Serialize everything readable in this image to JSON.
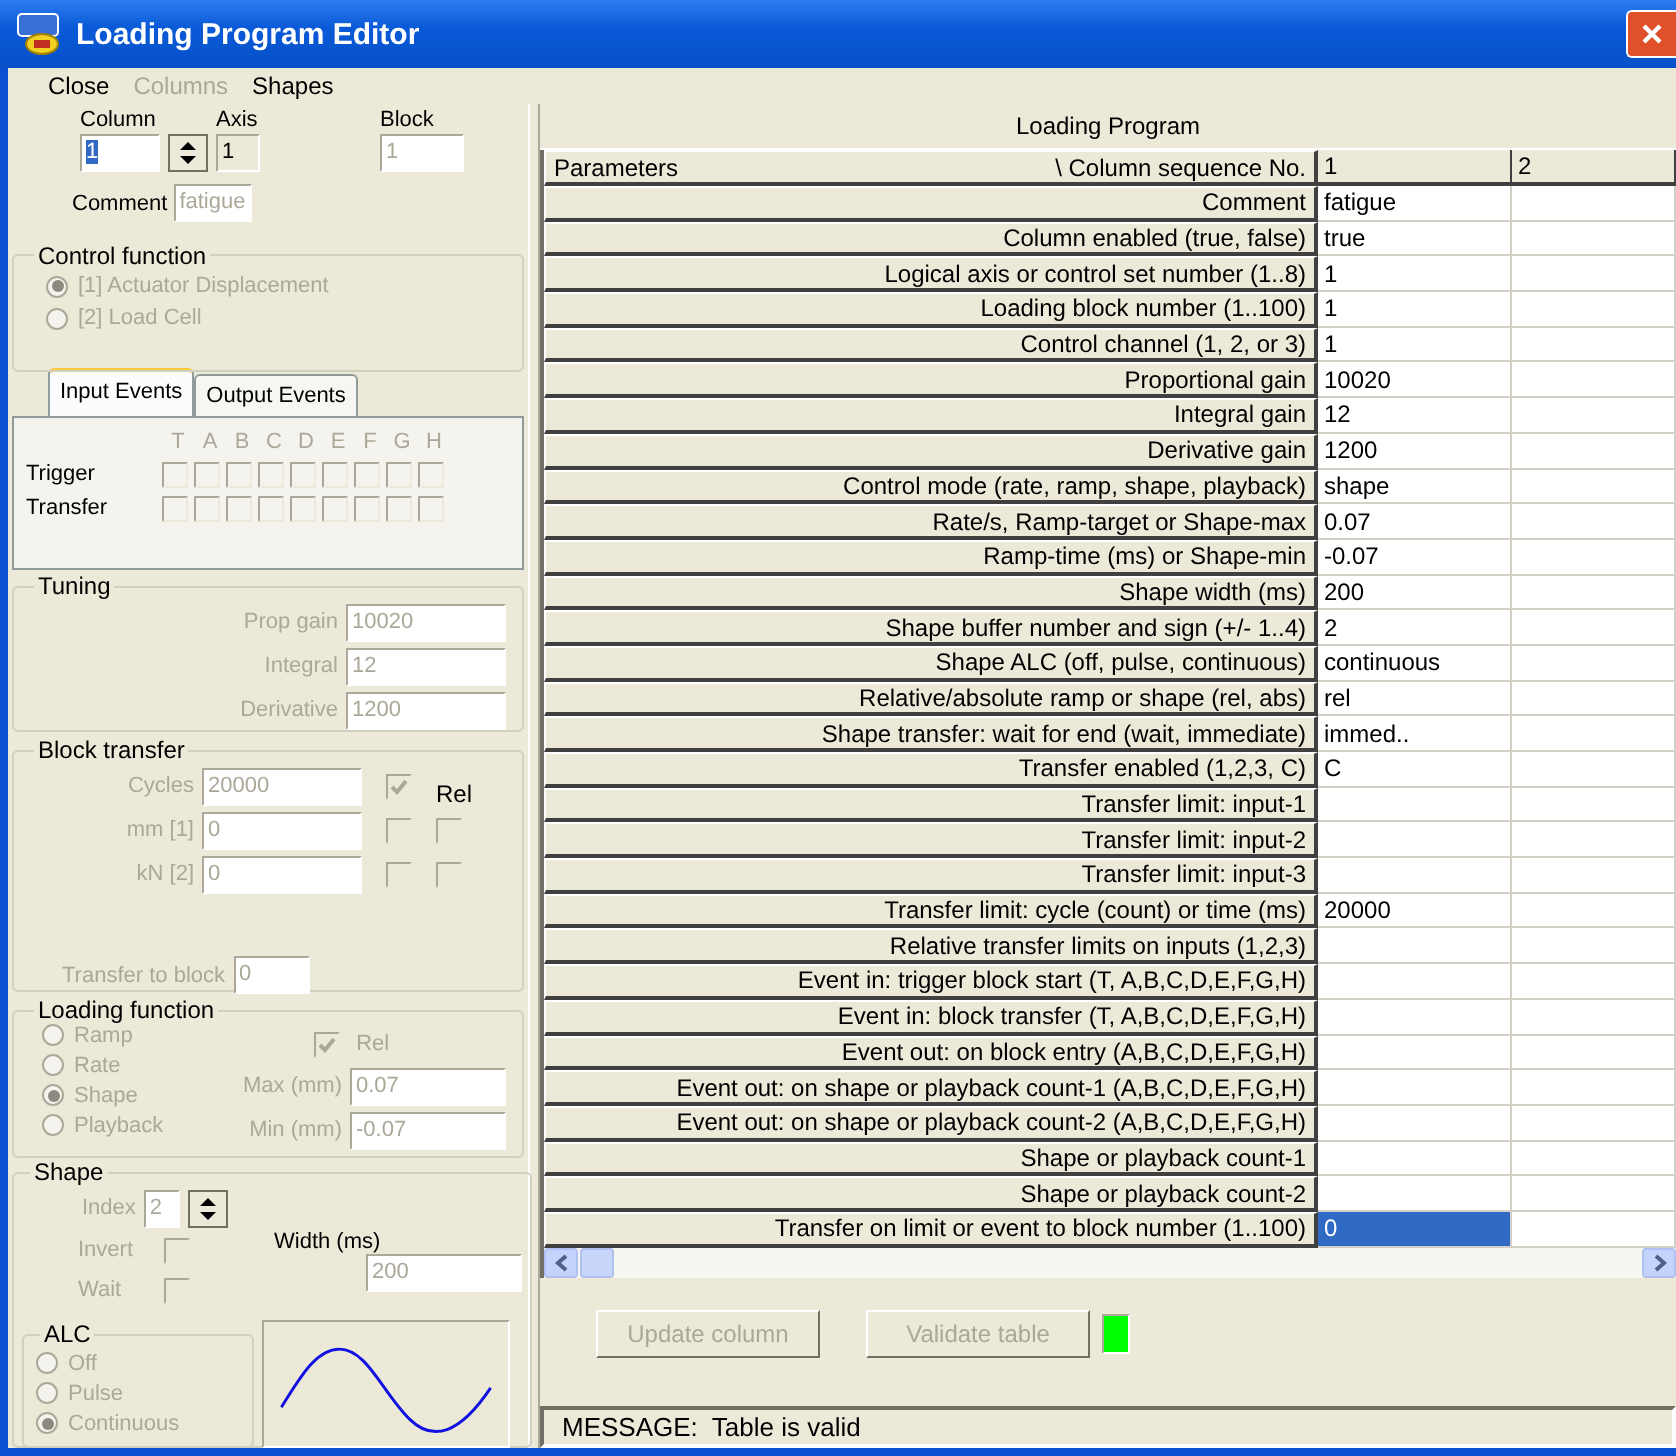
{
  "window": {
    "title": "Loading Program Editor"
  },
  "menu": [
    {
      "label": "Close",
      "disabled": false
    },
    {
      "label": "Columns",
      "disabled": true
    },
    {
      "label": "Shapes",
      "disabled": false
    }
  ],
  "selector": {
    "fields": [
      {
        "label": "Column",
        "value": "1",
        "kind": "spin",
        "disabled": false,
        "selected": true
      },
      {
        "label": "Axis",
        "value": "1",
        "kind": "readonly",
        "disabled": false,
        "selected": false
      },
      {
        "label": "Block",
        "value": "1",
        "kind": "text",
        "disabled": true,
        "selected": false
      }
    ],
    "comment": {
      "label": "Comment",
      "value": "fatigue",
      "disabled": true
    }
  },
  "control_function": {
    "title": "Control function",
    "disabled": true,
    "options": [
      {
        "label": "[1] Actuator Displacement",
        "selected": true
      },
      {
        "label": "[2] Load Cell",
        "selected": false
      }
    ]
  },
  "events": {
    "tabs": [
      {
        "label": "Input Events",
        "selected": true
      },
      {
        "label": "Output Events",
        "selected": false
      }
    ],
    "disabled": true,
    "letters": [
      "T",
      "A",
      "B",
      "C",
      "D",
      "E",
      "F",
      "G",
      "H"
    ],
    "rows": [
      {
        "label": "Trigger",
        "checks": [
          false,
          false,
          false,
          false,
          false,
          false,
          false,
          false,
          false
        ]
      },
      {
        "label": "Transfer",
        "checks": [
          false,
          false,
          false,
          false,
          false,
          false,
          false,
          false,
          false
        ]
      }
    ]
  },
  "tuning": {
    "title": "Tuning",
    "disabled": true,
    "fields": [
      {
        "label": "Prop gain",
        "value": "10020"
      },
      {
        "label": "Integral",
        "value": "12"
      },
      {
        "label": "Derivative",
        "value": "1200"
      }
    ]
  },
  "block_transfer": {
    "title": "Block transfer",
    "disabled": true,
    "rel_label": "Rel",
    "rows": [
      {
        "label": "Cycles",
        "value": "20000",
        "checks": [
          true
        ]
      },
      {
        "label": "mm [1]",
        "value": "0",
        "checks": [
          false,
          false
        ]
      },
      {
        "label": "kN [2]",
        "value": "0",
        "checks": [
          false,
          false
        ]
      }
    ],
    "transfer_to_block": {
      "label": "Transfer to block",
      "value": "0"
    }
  },
  "loading_function": {
    "title": "Loading function",
    "disabled": true,
    "options": [
      {
        "label": "Ramp",
        "selected": false
      },
      {
        "label": "Rate",
        "selected": false
      },
      {
        "label": "Shape",
        "selected": true
      },
      {
        "label": "Playback",
        "selected": false
      }
    ],
    "rel": {
      "label": "Rel",
      "checked": true
    },
    "fields": [
      {
        "label": "Max (mm)",
        "value": "0.07"
      },
      {
        "label": "Min (mm)",
        "value": "-0.07"
      }
    ]
  },
  "shape": {
    "title": "Shape",
    "disabled": true,
    "index": {
      "label": "Index",
      "value": "2"
    },
    "checks": [
      {
        "label": "Invert",
        "checked": false
      },
      {
        "label": "Wait",
        "checked": false
      }
    ],
    "width": {
      "label": "Width (ms)",
      "value": "200"
    },
    "alc": {
      "title": "ALC",
      "options": [
        {
          "label": "Off",
          "selected": false
        },
        {
          "label": "Pulse",
          "selected": false
        },
        {
          "label": "Continuous",
          "selected": true
        }
      ]
    }
  },
  "table": {
    "title": "Loading Program",
    "header": {
      "parameters": "Parameters",
      "sequence": "\\ Column sequence No.",
      "columns": [
        "1",
        "2"
      ]
    },
    "rows": [
      {
        "label": "Comment",
        "value": "fatigue",
        "selected": false
      },
      {
        "label": "Column enabled (true, false)",
        "value": "true",
        "selected": false
      },
      {
        "label": "Logical axis or control set number (1..8)",
        "value": "1",
        "selected": false
      },
      {
        "label": "Loading block number (1..100)",
        "value": "1",
        "selected": false
      },
      {
        "label": "Control channel (1, 2, or 3)",
        "value": "1",
        "selected": false
      },
      {
        "label": "Proportional gain",
        "value": "10020",
        "selected": false
      },
      {
        "label": "Integral gain",
        "value": "12",
        "selected": false
      },
      {
        "label": "Derivative gain",
        "value": "1200",
        "selected": false
      },
      {
        "label": "Control mode (rate, ramp, shape, playback)",
        "value": "shape",
        "selected": false
      },
      {
        "label": "Rate/s, Ramp-target or Shape-max",
        "value": "0.07",
        "selected": false
      },
      {
        "label": "Ramp-time (ms) or Shape-min",
        "value": "-0.07",
        "selected": false
      },
      {
        "label": "Shape width (ms)",
        "value": "200",
        "selected": false
      },
      {
        "label": "Shape buffer number and sign (+/- 1..4)",
        "value": "2",
        "selected": false
      },
      {
        "label": "Shape ALC (off, pulse, continuous)",
        "value": "continuous",
        "selected": false
      },
      {
        "label": "Relative/absolute ramp or shape (rel, abs)",
        "value": "rel",
        "selected": false
      },
      {
        "label": "Shape transfer: wait for end (wait, immediate)",
        "value": "immed..",
        "selected": false
      },
      {
        "label": "Transfer enabled (1,2,3, C)",
        "value": "C",
        "selected": false
      },
      {
        "label": "Transfer limit: input-1",
        "selected": false
      },
      {
        "label": "Transfer limit: input-2",
        "selected": false
      },
      {
        "label": "Transfer limit: input-3",
        "selected": false
      },
      {
        "label": "Transfer limit: cycle (count) or time (ms)",
        "value": "20000",
        "selected": false
      },
      {
        "label": "Relative transfer limits on inputs (1,2,3)",
        "selected": false
      },
      {
        "label": "Event in: trigger block start (T, A,B,C,D,E,F,G,H)",
        "selected": false
      },
      {
        "label": "Event in: block transfer (T, A,B,C,D,E,F,G,H)",
        "selected": false
      },
      {
        "label": "Event out: on block entry (A,B,C,D,E,F,G,H)",
        "selected": false
      },
      {
        "label": "Event out: on shape or playback count-1 (A,B,C,D,E,F,G,H)",
        "selected": false
      },
      {
        "label": "Event out: on shape or playback count-2 (A,B,C,D,E,F,G,H)",
        "selected": false
      },
      {
        "label": "Shape or playback count-1",
        "selected": false
      },
      {
        "label": "Shape or playback count-2",
        "selected": false
      },
      {
        "label": "Transfer on limit or event to block number (1..100)",
        "value": "0",
        "selected": true
      }
    ]
  },
  "buttons": [
    {
      "label": "Update column",
      "disabled": true
    },
    {
      "label": "Validate table",
      "disabled": true
    }
  ],
  "status_indicator": {
    "color": "#00ff00"
  },
  "message": "MESSAGE:  Table is valid"
}
